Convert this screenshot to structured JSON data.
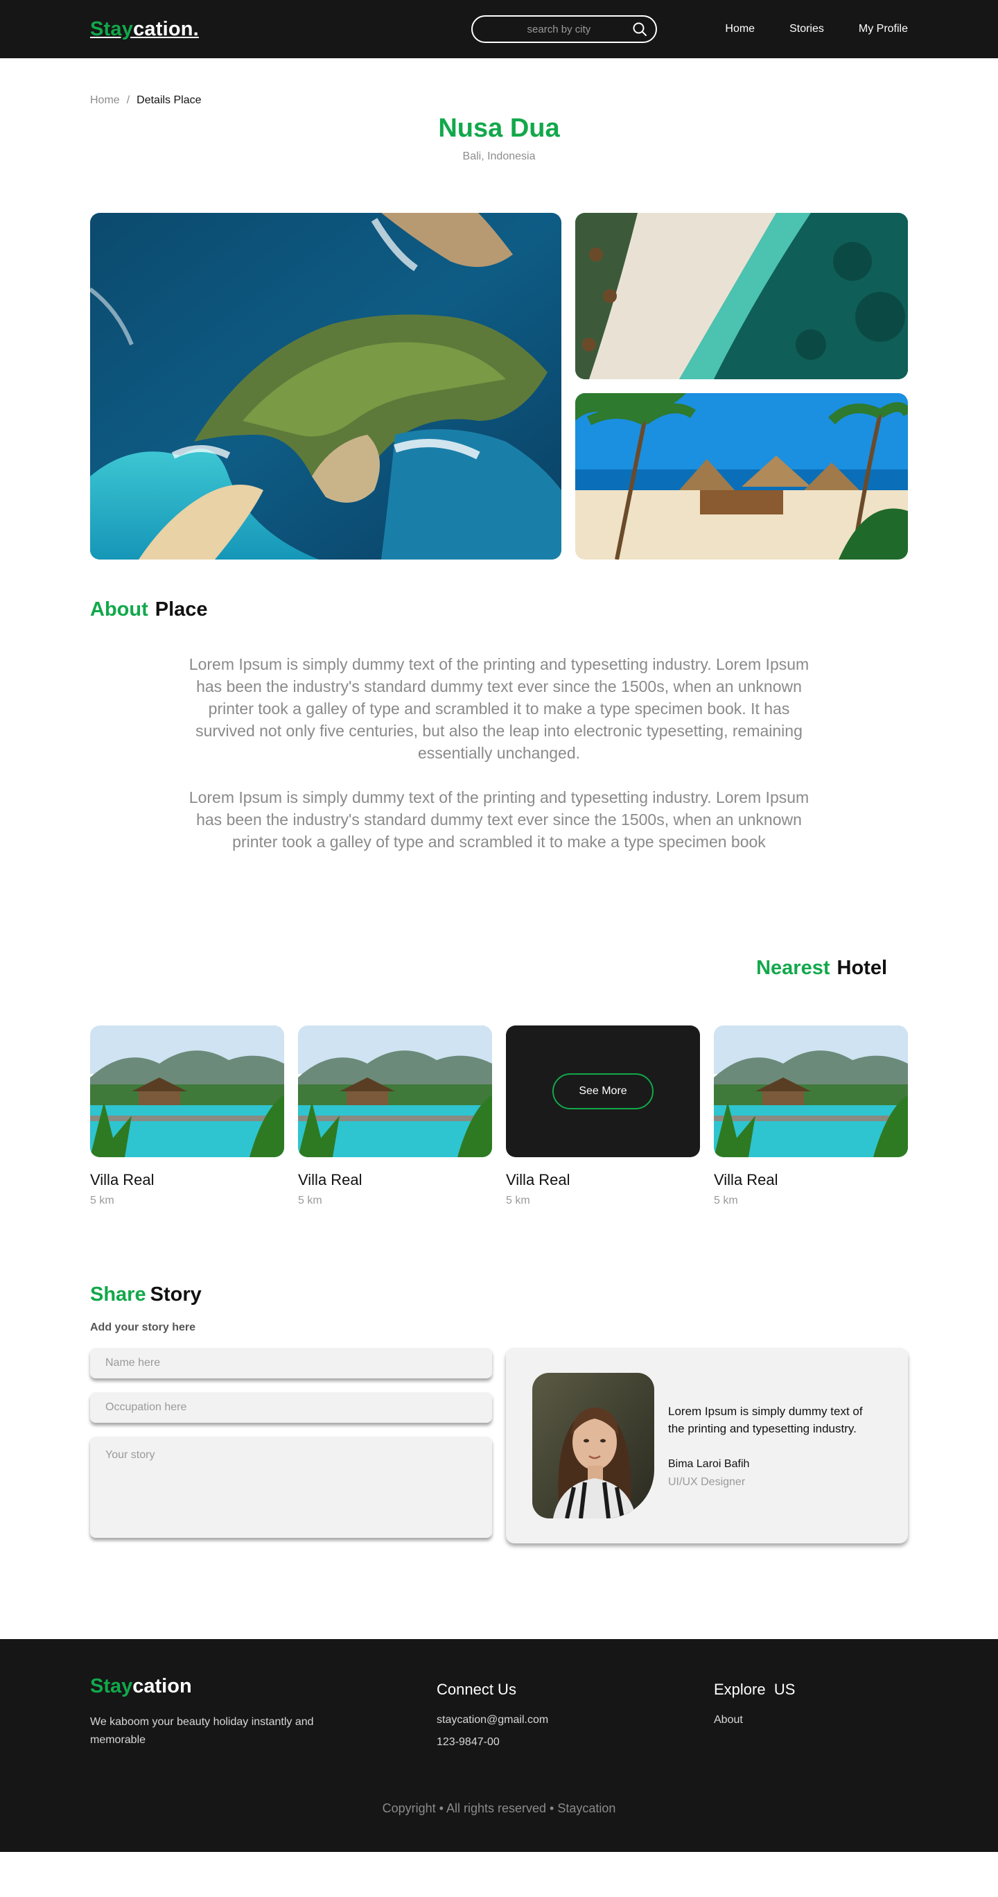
{
  "nav": {
    "logo_accent": "Stay",
    "logo_rest": "cation.",
    "search_placeholder": "search by city",
    "links": [
      "Home",
      "Stories",
      "My Profile"
    ]
  },
  "breadcrumb": {
    "home": "Home",
    "separator": "/",
    "current": "Details Place"
  },
  "place": {
    "title": "Nusa Dua",
    "location": "Bali, Indonesia"
  },
  "about": {
    "heading_accent": "About",
    "heading_rest": "Place",
    "paragraphs": [
      "Lorem Ipsum is simply dummy text of the printing and typesetting industry. Lorem Ipsum has been the industry's standard dummy text ever since the 1500s, when an unknown printer took a galley of type and scrambled it to make a type specimen book. It has survived not only five centuries, but also the leap into electronic typesetting, remaining essentially unchanged.",
      "Lorem Ipsum is simply dummy text of the printing and typesetting industry. Lorem Ipsum has been the industry's standard dummy text ever since the 1500s, when an unknown printer took a galley of type and scrambled it to make a type specimen book"
    ]
  },
  "nearest": {
    "heading_accent": "Nearest",
    "heading_rest": "Hotel",
    "see_more": "See More",
    "hotels": [
      {
        "name": "Villa Real",
        "distance": "5 km"
      },
      {
        "name": "Villa Real",
        "distance": "5 km"
      },
      {
        "name": "Villa Real",
        "distance": "5 km"
      },
      {
        "name": "Villa Real",
        "distance": "5 km"
      }
    ]
  },
  "share": {
    "heading_accent": "Share",
    "heading_rest": "Story",
    "subheading": "Add your story here",
    "name_placeholder": "Name here",
    "occupation_placeholder": "Occupation here",
    "story_placeholder": "Your story",
    "card": {
      "quote": "Lorem Ipsum is simply dummy text of the printing and typesetting industry.",
      "author": "Bima Laroi Bafih",
      "role": "UI/UX Designer"
    }
  },
  "footer": {
    "logo_accent": "Stay",
    "logo_rest": "cation",
    "tagline": "We kaboom your beauty holiday instantly and memorable",
    "connect_heading": "Connect Us",
    "email": "staycation@gmail.com",
    "phone": "123-9847-00",
    "explore_heading": "Explore  US",
    "explore_links": [
      "About"
    ],
    "copyright": "Copyright • All rights reserved • Staycation"
  },
  "colors": {
    "accent": "#12a84b",
    "dark": "#161616",
    "muted": "#8d8d8d"
  }
}
